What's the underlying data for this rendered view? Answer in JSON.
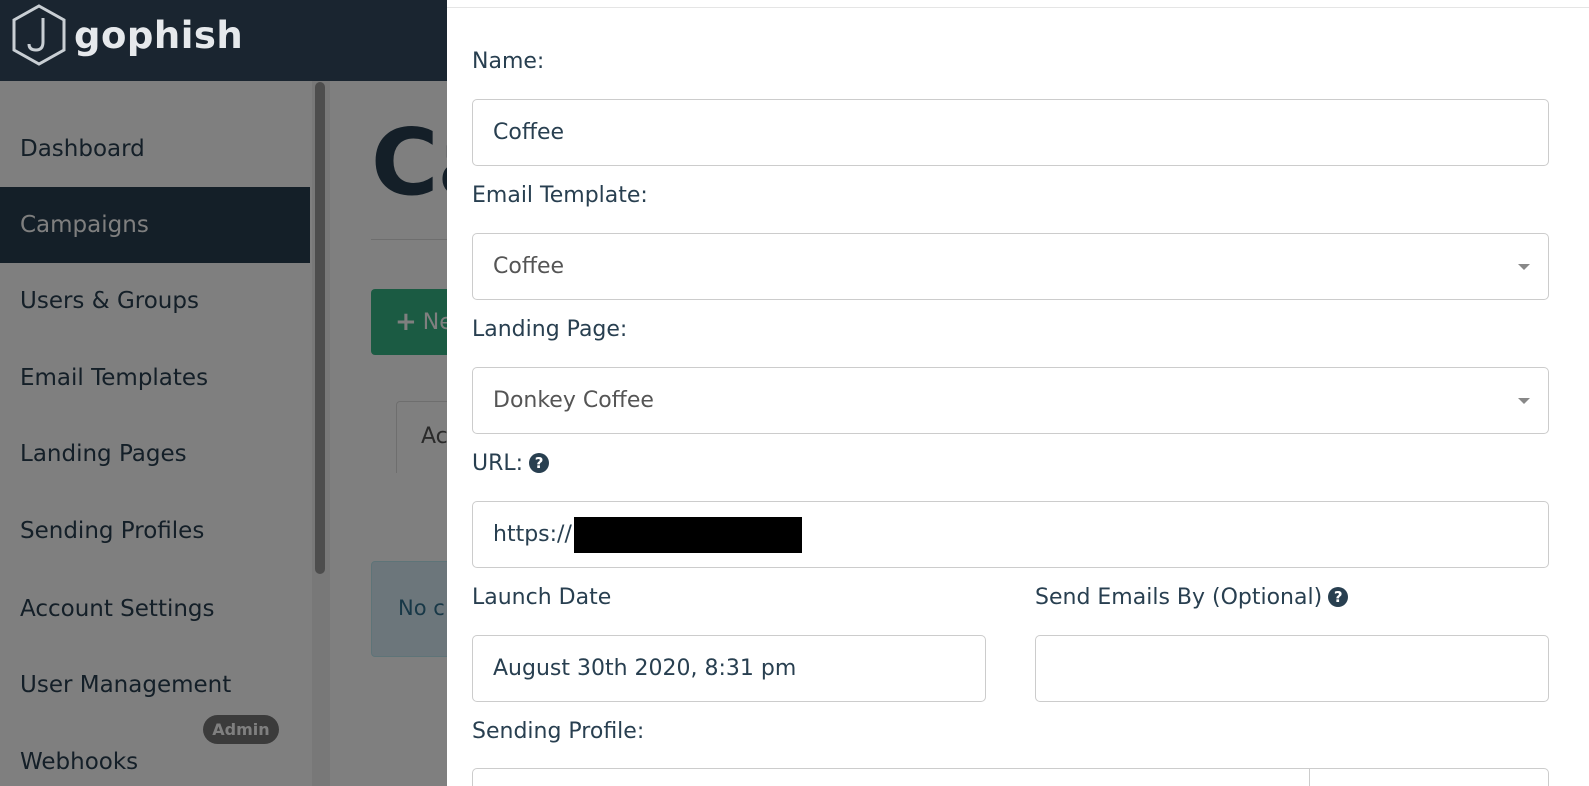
{
  "app": {
    "brand": "gophish"
  },
  "sidebar": {
    "items": [
      {
        "label": "Dashboard"
      },
      {
        "label": "Campaigns"
      },
      {
        "label": "Users & Groups"
      },
      {
        "label": "Email Templates"
      },
      {
        "label": "Landing Pages"
      },
      {
        "label": "Sending Profiles"
      },
      {
        "label": "Account Settings"
      },
      {
        "label": "User Management"
      },
      {
        "label": "Webhooks"
      }
    ],
    "active_index": 1,
    "admin_badge": "Admin"
  },
  "main": {
    "title_partial": "Ca",
    "new_button_label": "Ne",
    "tab_label_partial": "Ac",
    "alert_partial": "No c"
  },
  "modal": {
    "name_label": "Name:",
    "name_value": "Coffee",
    "template_label": "Email Template:",
    "template_value": "Coffee",
    "landing_label": "Landing Page:",
    "landing_value": "Donkey Coffee",
    "url_label": "URL:",
    "url_value": "https://",
    "launch_label": "Launch Date",
    "launch_value": "August 30th 2020, 8:31 pm",
    "send_by_label": "Send Emails By (Optional)",
    "send_by_value": "",
    "sending_profile_label": "Sending Profile:"
  },
  "colors": {
    "navbar": "#1a2530",
    "sidebar_active": "#283f50",
    "success": "#37b787",
    "text": "#283f50"
  },
  "icons": {
    "logo": "hook-hexagon-icon",
    "help": "question-circle-icon",
    "plus": "plus-icon",
    "caret": "caret-down-icon"
  }
}
